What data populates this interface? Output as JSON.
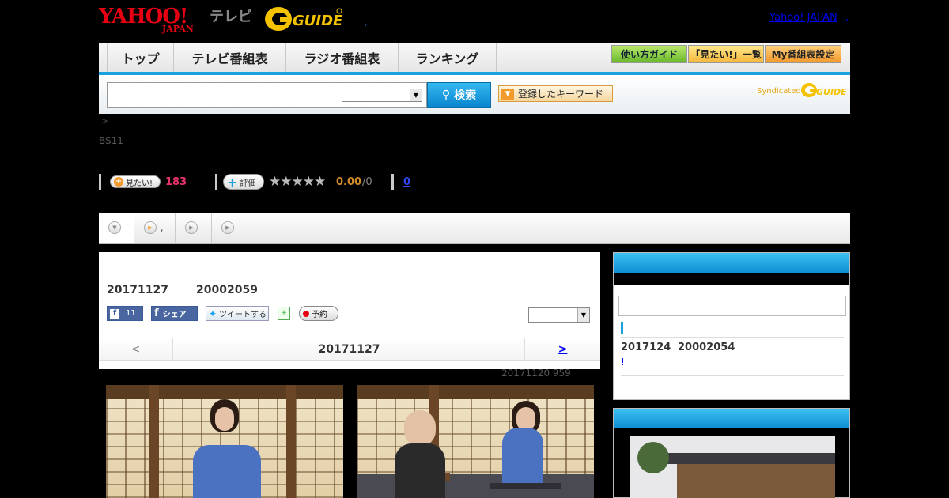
{
  "header": {
    "yahoo_logo": "YAHOO!",
    "yahoo_logo_sub": "JAPAN",
    "tv_label": "テレビ",
    "gguide_logo": "GUIDE",
    "header_dot": ",",
    "yahoo_japan_link": "Yahoo! JAPAN",
    "yahoo_japan_dot": ","
  },
  "nav": {
    "tabs": [
      {
        "label": "トップ"
      },
      {
        "label": "テレビ番組表"
      },
      {
        "label": "ラジオ番組表"
      },
      {
        "label": "ランキング"
      }
    ],
    "buttons": [
      {
        "label": "使い方ガイド"
      },
      {
        "label": "「見たい!」一覧"
      },
      {
        "label": "My番組表設定"
      }
    ]
  },
  "search": {
    "input_value": "",
    "select_value": "",
    "button_label": "検索",
    "keyword_button_label": "登録したキーワード",
    "syndicated_label": "Syndicated",
    "syndicated_logo": "GUIDE"
  },
  "program": {
    "breadcrumb_arrow": ">",
    "channel": "BS11",
    "mitai_label": "見たい!",
    "mitai_count": "183",
    "hyoka_label": "評価",
    "stars": "★★★★★",
    "score": "0.00",
    "score_den": "/0",
    "review_count": "0",
    "rating_value": 0
  },
  "subtabs": [
    {
      "label": "",
      "icon": "chevron-down-icon"
    },
    {
      "label": ",",
      "icon": "play-icon"
    },
    {
      "label": "",
      "icon": "play-icon"
    },
    {
      "label": "",
      "icon": "play-icon"
    }
  ],
  "episode": {
    "air_date": "20171127",
    "air_code": "20002059",
    "fb_like_count": "11",
    "fb_share_label": "シェア",
    "tweet_label": "ツイートする",
    "calendar_icon": "calendar-add-icon",
    "record_label": "予約",
    "select_value": "",
    "prev_label": "<",
    "nav_date": "20171127",
    "next_label": ">",
    "updated": "20171120  959"
  },
  "sidebar": {
    "box1_title": "",
    "input_value": "",
    "ep_date": "2017124",
    "ep_code": "20002054",
    "link_label": "!",
    "box2_title": ""
  },
  "colors": {
    "accent_blue": "#1aa0dc",
    "yahoo_red": "#e60012",
    "mitai_pink": "#e8336a",
    "score_orange": "#d08a2a"
  }
}
